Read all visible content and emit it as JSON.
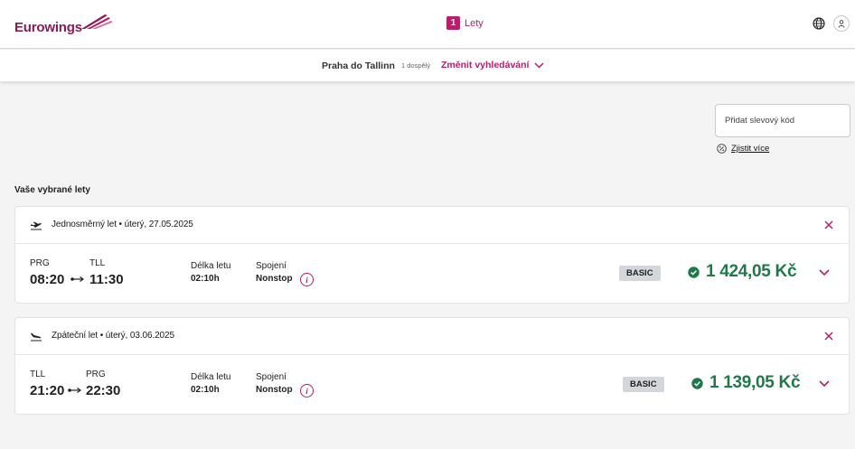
{
  "header": {
    "brand": "Eurowings",
    "step_number": "1",
    "step_label": "Lety",
    "icons": [
      "globe-icon",
      "user-icon"
    ],
    "brand_color": "#8c1b53",
    "accent_color": "#b71f68"
  },
  "subbar": {
    "route": "Praha do Tallinn",
    "passengers": "1 dospělý",
    "change_label": "Změnit vyhledávání"
  },
  "voucher": {
    "placeholder": "Přidat slevový kód",
    "learn_more": "Zjistit více"
  },
  "selected_title": "Vaše vybrané lety",
  "flights": [
    {
      "heading": "Jednosměrný let • úterý, 27.05.2025",
      "origin": "PRG",
      "destination": "TLL",
      "departure": "08:20",
      "arrival": "11:30",
      "duration_label": "Délka letu",
      "duration": "02:10h",
      "connection_label": "Spojení",
      "connection": "Nonstop",
      "fare": "BASIC",
      "price": "1 424,05 Kč"
    },
    {
      "heading": "Zpáteční let • úterý, 03.06.2025",
      "origin": "TLL",
      "destination": "PRG",
      "departure": "21:20",
      "arrival": "22:30",
      "duration_label": "Délka letu",
      "duration": "02:10h",
      "connection_label": "Spojení",
      "connection": "Nonstop",
      "fare": "BASIC",
      "price": "1 139,05 Kč"
    }
  ],
  "price_color": "#1f7a4a"
}
